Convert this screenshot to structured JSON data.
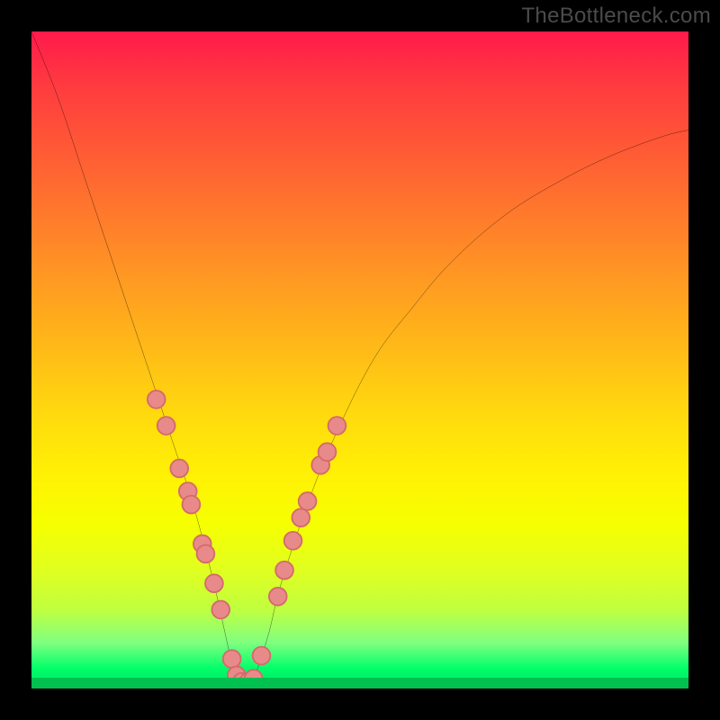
{
  "watermark": "TheBottleneck.com",
  "colors": {
    "frame": "#000000",
    "watermark_text": "#4b4b4b",
    "curve_stroke": "#000000",
    "dot_fill": "#e88a8a",
    "dot_stroke": "#d46a6a",
    "gradient_top": "#ff1a4b",
    "gradient_bottom": "#00e060"
  },
  "chart_data": {
    "type": "line",
    "title": "",
    "xlabel": "",
    "ylabel": "",
    "xlim": [
      0,
      100
    ],
    "ylim": [
      0,
      100
    ],
    "grid": false,
    "series": [
      {
        "name": "bottleneck-curve",
        "x": [
          0,
          4,
          8,
          12,
          16,
          20,
          22,
          24,
          26,
          28,
          30,
          31,
          32,
          33,
          34,
          36,
          38,
          42,
          46,
          52,
          58,
          64,
          72,
          80,
          88,
          96,
          100
        ],
        "y": [
          100,
          90,
          78,
          66,
          54,
          42,
          36,
          30,
          23,
          15,
          6,
          2,
          1,
          1,
          2,
          8,
          16,
          28,
          38,
          50,
          58,
          65,
          72,
          77,
          81,
          84,
          85
        ]
      }
    ],
    "highlight_dots": [
      {
        "x": 19.0,
        "y": 44.0
      },
      {
        "x": 20.5,
        "y": 40.0
      },
      {
        "x": 22.5,
        "y": 33.5
      },
      {
        "x": 23.8,
        "y": 30.0
      },
      {
        "x": 24.3,
        "y": 28.0
      },
      {
        "x": 26.0,
        "y": 22.0
      },
      {
        "x": 26.5,
        "y": 20.5
      },
      {
        "x": 27.8,
        "y": 16.0
      },
      {
        "x": 28.8,
        "y": 12.0
      },
      {
        "x": 30.5,
        "y": 4.5
      },
      {
        "x": 31.2,
        "y": 2.0
      },
      {
        "x": 32.0,
        "y": 1.0
      },
      {
        "x": 33.0,
        "y": 1.0
      },
      {
        "x": 33.8,
        "y": 1.5
      },
      {
        "x": 35.0,
        "y": 5.0
      },
      {
        "x": 37.5,
        "y": 14.0
      },
      {
        "x": 38.5,
        "y": 18.0
      },
      {
        "x": 39.8,
        "y": 22.5
      },
      {
        "x": 41.0,
        "y": 26.0
      },
      {
        "x": 42.0,
        "y": 28.5
      },
      {
        "x": 44.0,
        "y": 34.0
      },
      {
        "x": 45.0,
        "y": 36.0
      },
      {
        "x": 46.5,
        "y": 40.0
      }
    ],
    "dot_radius_percent": 1.35
  }
}
